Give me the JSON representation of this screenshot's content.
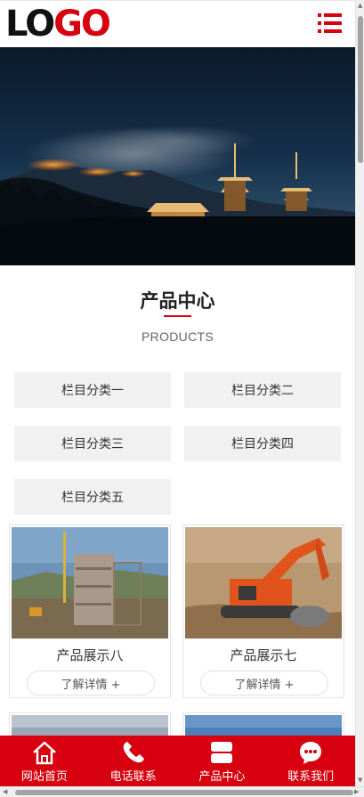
{
  "header": {
    "logo_part1": "LO",
    "logo_part2": "GO",
    "menu_icon": "hamburger-menu-icon"
  },
  "section": {
    "title": "产品中心",
    "subtitle": "PRODUCTS"
  },
  "categories": [
    {
      "label": "栏目分类一"
    },
    {
      "label": "栏目分类二"
    },
    {
      "label": "栏目分类三"
    },
    {
      "label": "栏目分类四"
    },
    {
      "label": "栏目分类五"
    }
  ],
  "products": [
    {
      "title": "产品展示八",
      "more": "了解详情 +"
    },
    {
      "title": "产品展示七",
      "more": "了解详情 +"
    }
  ],
  "bottom_nav": [
    {
      "label": "网站首页",
      "icon": "home-icon"
    },
    {
      "label": "电话联系",
      "icon": "phone-icon"
    },
    {
      "label": "产品中心",
      "icon": "product-icon"
    },
    {
      "label": "联系我们",
      "icon": "chat-icon"
    }
  ],
  "colors": {
    "brand_red": "#d7000f",
    "category_bg": "#f1f1f1"
  }
}
